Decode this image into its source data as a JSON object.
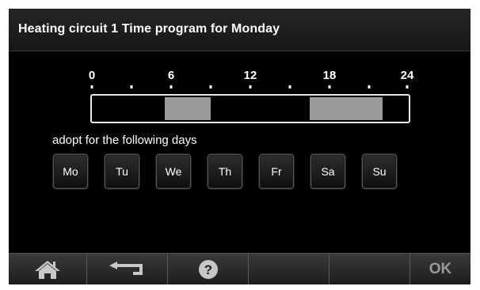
{
  "header": {
    "title": "Heating circuit 1 Time program for Monday"
  },
  "timeline": {
    "tick_labels": [
      "0",
      "6",
      "12",
      "18",
      "24"
    ],
    "range_hours": [
      0,
      24
    ],
    "heating_periods": [
      {
        "start_hour": 5.5,
        "end_hour": 9.0
      },
      {
        "start_hour": 16.5,
        "end_hour": 22.0
      }
    ]
  },
  "adopt_label": "adopt for the following days",
  "days": [
    "Mo",
    "Tu",
    "We",
    "Th",
    "Fr",
    "Sa",
    "Su"
  ],
  "bottom_bar": {
    "home_icon": "home-icon",
    "back_icon": "back-arrow-icon",
    "help_icon": "help-icon",
    "ok_label": "OK"
  },
  "colors": {
    "heating_period": "#9a9a9a",
    "background": "#000000",
    "text": "#ffffff"
  }
}
